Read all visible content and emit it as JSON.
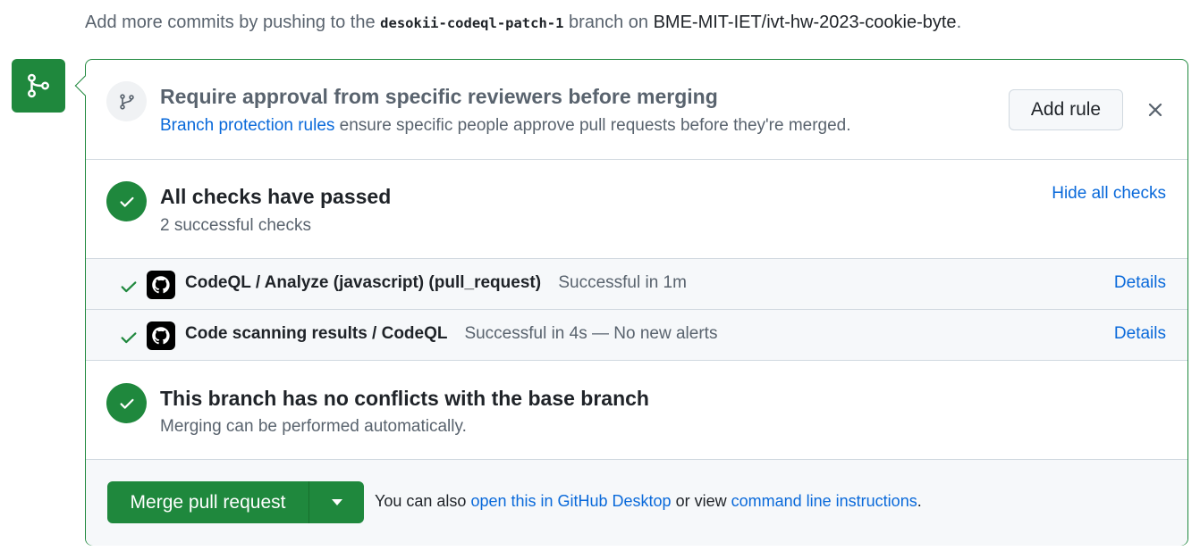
{
  "top_note": {
    "prefix": "Add more commits by pushing to the",
    "branch": "desokii-codeql-patch-1",
    "middle": "branch on",
    "repo": "BME-MIT-IET/ivt-hw-2023-cookie-byte",
    "suffix": "."
  },
  "approval": {
    "icon": "git-branch-icon",
    "title": "Require approval from specific reviewers before merging",
    "link": "Branch protection rules",
    "text": "ensure specific people approve pull requests before they're merged.",
    "add_rule_label": "Add rule",
    "close_icon": "close-icon"
  },
  "checks": {
    "title": "All checks have passed",
    "subtitle": "2 successful checks",
    "toggle_label": "Hide all checks",
    "items": [
      {
        "name": "CodeQL / Analyze (javascript) (pull_request)",
        "status": "Successful in 1m",
        "details_label": "Details"
      },
      {
        "name": "Code scanning results / CodeQL",
        "status": "Successful in 4s — No new alerts",
        "details_label": "Details"
      }
    ]
  },
  "conflicts": {
    "title": "This branch has no conflicts with the base branch",
    "subtitle": "Merging can be performed automatically."
  },
  "merge": {
    "button_label": "Merge pull request",
    "note_prefix": "You can also",
    "desktop_link": "open this in GitHub Desktop",
    "note_middle": "or view",
    "cli_link": "command line instructions",
    "note_suffix": "."
  },
  "colors": {
    "success": "#1f883d",
    "link": "#0969da",
    "muted": "#59636e"
  }
}
